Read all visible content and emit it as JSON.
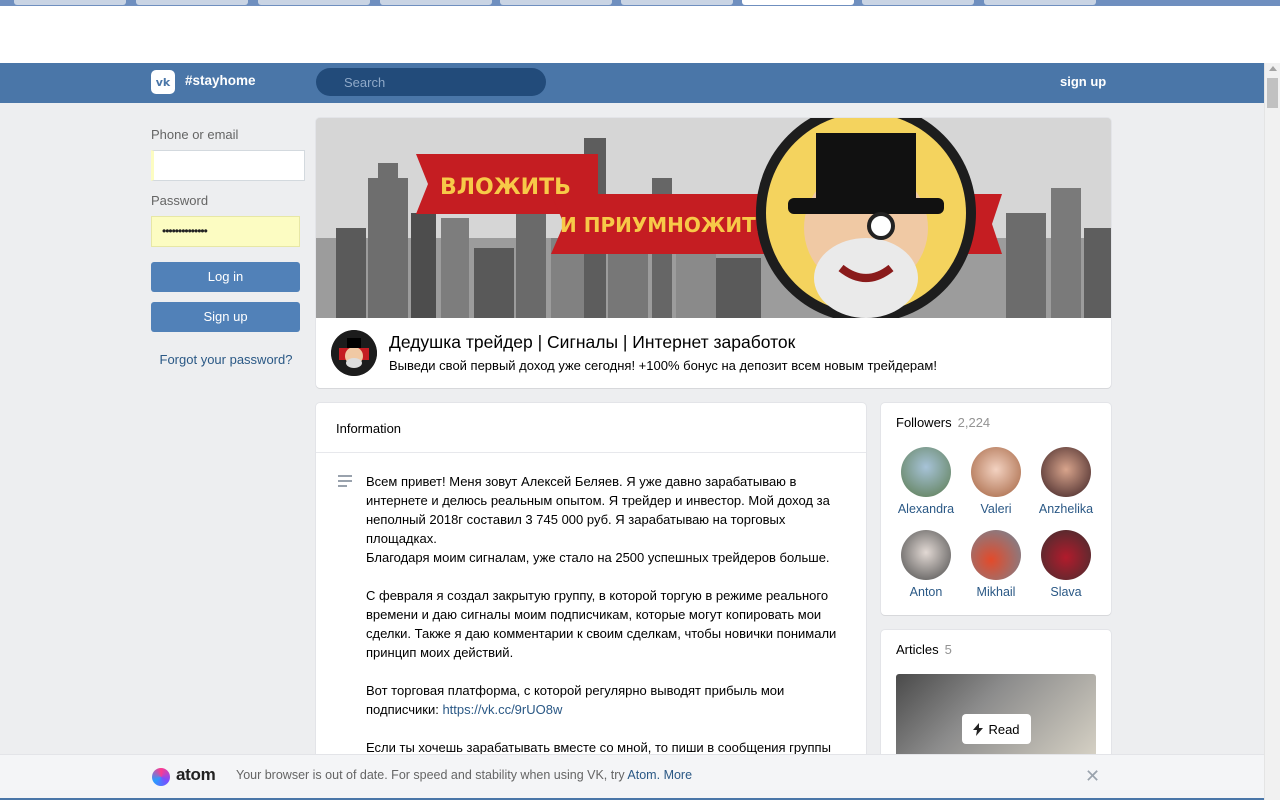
{
  "header": {
    "logo": "vk",
    "brand": "#stayhome",
    "search_placeholder": "Search",
    "signup": "sign up"
  },
  "login": {
    "phone_label": "Phone or email",
    "password_label": "Password",
    "password_mask": "••••••••••••••",
    "login_button": "Log in",
    "signup_button": "Sign up",
    "forgot": "Forgot your password?"
  },
  "community": {
    "cover_text_1": "ВЛОЖИТЬ",
    "cover_text_2": "И ПРИУМНОЖИТЬ",
    "title": "Дедушка трейдер | Сигналы | Интернет заработок",
    "subtitle": "Выведи свой первый доход уже сегодня! +100% бонус на депозит всем новым трейдерам!"
  },
  "information": {
    "heading": "Information",
    "p1a": "Всем привет! Меня зовут Алексей Беляев. Я уже давно зарабатываю в интернете и делюсь реальным опытом. Я трейдер и инвестор. Мой доход за неполный 2018г составил 3 745 000 руб. Я зарабатываю на торговых площадках.",
    "p1b": "Благодаря моим сигналам, уже стало на 2500 успешных трейдеров больше.",
    "p2": "С февраля я создал закрытую группу, в которой торгую в режиме реального времени и даю сигналы моим подписчикам, которые могут копировать мои сделки. Также я даю комментарии к своим сделкам, чтобы новички понимали принцип моих действий.",
    "p3": "Вот торговая платформа, с которой регулярно выводят прибыль мои подписчики: ",
    "p3_link": "https://vk.cc/9rUO8w",
    "p4": "Если ты хочешь зарабатывать вместе со мной, то пиши в сообщения группы"
  },
  "followers": {
    "title": "Followers",
    "count": "2,224",
    "items": [
      {
        "name": "Alexandra"
      },
      {
        "name": "Valeri"
      },
      {
        "name": "Anzhelika"
      },
      {
        "name": "Anton"
      },
      {
        "name": "Mikhail"
      },
      {
        "name": "Slava"
      }
    ]
  },
  "articles": {
    "title": "Articles",
    "count": "5",
    "read": "Read"
  },
  "atom_bar": {
    "name": "atom",
    "text": "Your browser is out of date. For speed and stability when using VK, try ",
    "link1": "Atom.",
    "link2": "More"
  },
  "icons": {
    "search": "search-icon",
    "close": "close-icon",
    "lightning": "lightning-icon",
    "description": "description-icon"
  }
}
